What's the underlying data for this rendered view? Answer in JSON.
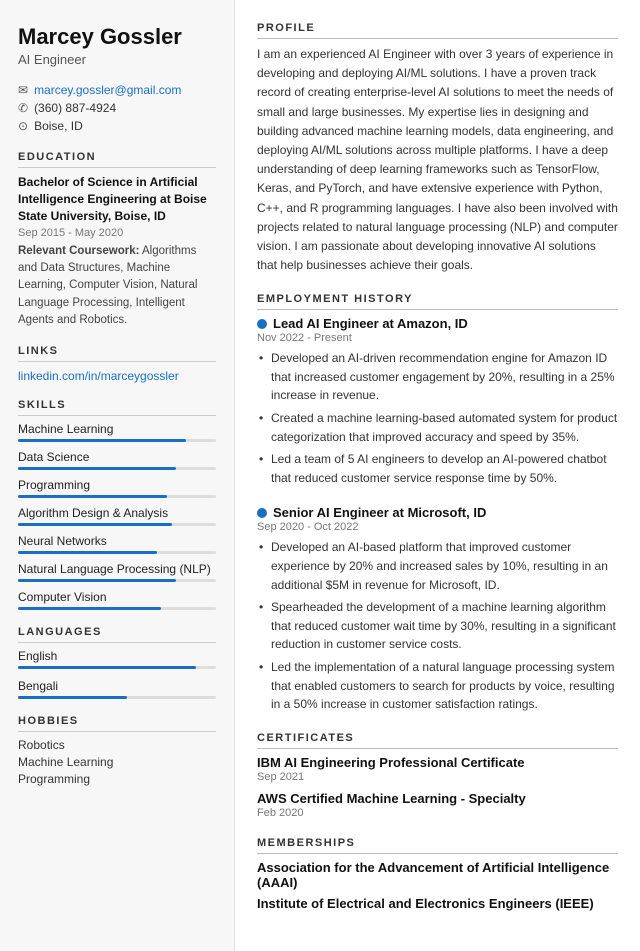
{
  "sidebar": {
    "name": "Marcey Gossler",
    "job_title": "AI Engineer",
    "contact": {
      "email": "marcey.gossler@gmail.com",
      "phone": "(360) 887-4924",
      "location": "Boise, ID"
    },
    "education": {
      "heading": "EDUCATION",
      "degree": "Bachelor of Science in Artificial Intelligence Engineering at Boise State University, Boise, ID",
      "date": "Sep 2015 - May 2020",
      "coursework_label": "Relevant Coursework:",
      "coursework": "Algorithms and Data Structures, Machine Learning, Computer Vision, Natural Language Processing, Intelligent Agents and Robotics."
    },
    "links": {
      "heading": "LINKS",
      "linkedin": "linkedin.com/in/marceygossler"
    },
    "skills": {
      "heading": "SKILLS",
      "items": [
        {
          "label": "Machine Learning",
          "pct": 85
        },
        {
          "label": "Data Science",
          "pct": 80
        },
        {
          "label": "Programming",
          "pct": 75
        },
        {
          "label": "Algorithm Design & Analysis",
          "pct": 78
        },
        {
          "label": "Neural Networks",
          "pct": 70
        },
        {
          "label": "Natural Language Processing (NLP)",
          "pct": 80
        },
        {
          "label": "Computer Vision",
          "pct": 72
        }
      ]
    },
    "languages": {
      "heading": "LANGUAGES",
      "items": [
        {
          "label": "English",
          "pct": 90
        },
        {
          "label": "Bengali",
          "pct": 55
        }
      ]
    },
    "hobbies": {
      "heading": "HOBBIES",
      "items": [
        "Robotics",
        "Machine Learning",
        "Programming"
      ]
    }
  },
  "main": {
    "profile": {
      "heading": "PROFILE",
      "text": "I am an experienced AI Engineer with over 3 years of experience in developing and deploying AI/ML solutions. I have a proven track record of creating enterprise-level AI solutions to meet the needs of small and large businesses. My expertise lies in designing and building advanced machine learning models, data engineering, and deploying AI/ML solutions across multiple platforms. I have a deep understanding of deep learning frameworks such as TensorFlow, Keras, and PyTorch, and have extensive experience with Python, C++, and R programming languages. I have also been involved with projects related to natural language processing (NLP) and computer vision. I am passionate about developing innovative AI solutions that help businesses achieve their goals."
    },
    "employment": {
      "heading": "EMPLOYMENT HISTORY",
      "jobs": [
        {
          "title": "Lead AI Engineer at Amazon, ID",
          "date": "Nov 2022 - Present",
          "bullets": [
            "Developed an AI-driven recommendation engine for Amazon ID that increased customer engagement by 20%, resulting in a 25% increase in revenue.",
            "Created a machine learning-based automated system for product categorization that improved accuracy and speed by 35%.",
            "Led a team of 5 AI engineers to develop an AI-powered chatbot that reduced customer service response time by 50%."
          ]
        },
        {
          "title": "Senior AI Engineer at Microsoft, ID",
          "date": "Sep 2020 - Oct 2022",
          "bullets": [
            "Developed an AI-based platform that improved customer experience by 20% and increased sales by 10%, resulting in an additional $5M in revenue for Microsoft, ID.",
            "Spearheaded the development of a machine learning algorithm that reduced customer wait time by 30%, resulting in a significant reduction in customer service costs.",
            "Led the implementation of a natural language processing system that enabled customers to search for products by voice, resulting in a 50% increase in customer satisfaction ratings."
          ]
        }
      ]
    },
    "certificates": {
      "heading": "CERTIFICATES",
      "items": [
        {
          "name": "IBM AI Engineering Professional Certificate",
          "date": "Sep 2021"
        },
        {
          "name": "AWS Certified Machine Learning - Specialty",
          "date": "Feb 2020"
        }
      ]
    },
    "memberships": {
      "heading": "MEMBERSHIPS",
      "items": [
        "Association for the Advancement of Artificial Intelligence (AAAI)",
        "Institute of Electrical and Electronics Engineers (IEEE)"
      ]
    }
  },
  "icons": {
    "email": "✉",
    "phone": "✆",
    "location": "⊙"
  }
}
